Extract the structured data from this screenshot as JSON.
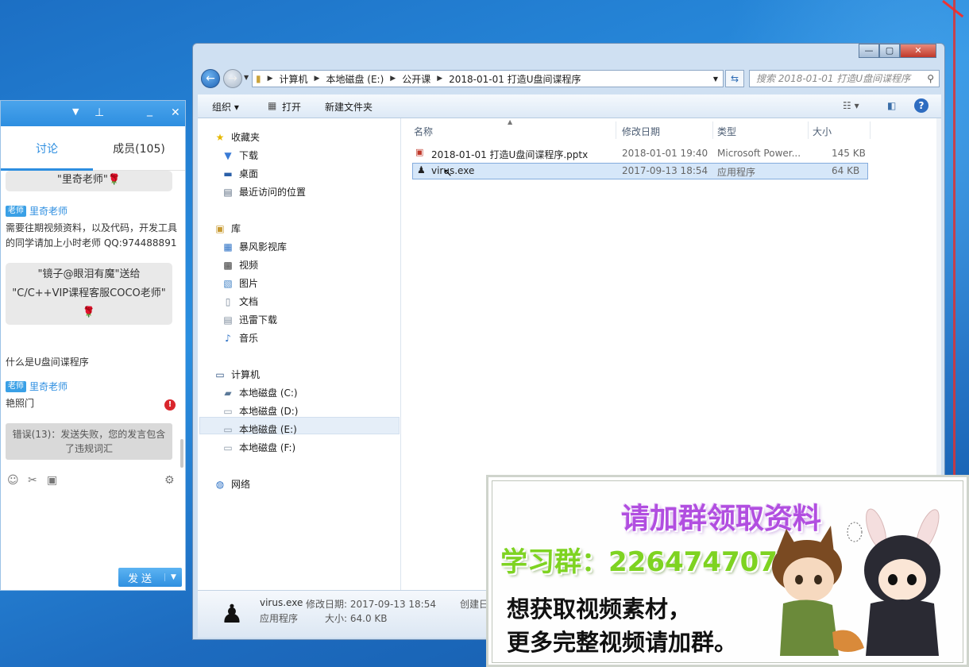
{
  "chat": {
    "tabs": {
      "discuss": "讨论",
      "members": "成员(105)"
    },
    "bubble1": "\"里奇老师\"🌹",
    "badge": "老师",
    "teacher": "里奇老师",
    "msg1_line1": "需要往期视频资料，以及代码，开发工具",
    "msg1_line2": "的同学请加上小时老师 QQ:974488891",
    "bubble2_line1": "\"镜子@眼泪有魔\"送给",
    "bubble2_line2": "\"C/C++VIP课程客服COCO老师\"",
    "bubble2_line3": "🌹",
    "msg2": "什么是U盘间谍程序",
    "msg3": "艳照门",
    "error_line1": "错误(13)：发送失败，您的发言包含",
    "error_line2": "了违规词汇",
    "send": "发送",
    "alert_icon": "!"
  },
  "explorer": {
    "breadcrumb": [
      "计算机",
      "本地磁盘 (E:)",
      "公开课",
      "2018-01-01 打造U盘间谍程序"
    ],
    "search_placeholder": "搜索 2018-01-01 打造U盘间谍程序",
    "toolbar": {
      "organize": "组织 ▾",
      "open": "打开",
      "new_folder": "新建文件夹"
    },
    "nav": {
      "favorites": "收藏夹",
      "downloads": "下载",
      "desktop": "桌面",
      "recent": "最近访问的位置",
      "library": "库",
      "baofeng": "暴风影视库",
      "video": "视频",
      "pictures": "图片",
      "documents": "文档",
      "xunlei": "迅雷下载",
      "music": "音乐",
      "computer": "计算机",
      "drive_c": "本地磁盘 (C:)",
      "drive_d": "本地磁盘 (D:)",
      "drive_e": "本地磁盘 (E:)",
      "drive_f": "本地磁盘 (F:)",
      "network": "网络"
    },
    "columns": {
      "name": "名称",
      "date": "修改日期",
      "type": "类型",
      "size": "大小"
    },
    "files": [
      {
        "name": "2018-01-01 打造U盘间谍程序.pptx",
        "date": "2018-01-01 19:40",
        "type": "Microsoft Power...",
        "size": "145 KB"
      },
      {
        "name": "virus.exe",
        "date": "2017-09-13 18:54",
        "type": "应用程序",
        "size": "64 KB"
      }
    ],
    "status": {
      "name": "virus.exe",
      "modified": "修改日期: 2017-09-13 18:54",
      "created": "创建日",
      "type": "应用程序",
      "size": "大小: 64.0 KB"
    }
  },
  "ad": {
    "headline": "请加群领取资料",
    "group": "学习群：226474707",
    "line1": "想获取视频素材，",
    "line2": "更多完整视频请加群。"
  },
  "colors": {
    "accent": "#2d8ee0",
    "ad_purple": "#b14ee0",
    "ad_green": "#7ed321",
    "error_red": "#d9262c"
  }
}
